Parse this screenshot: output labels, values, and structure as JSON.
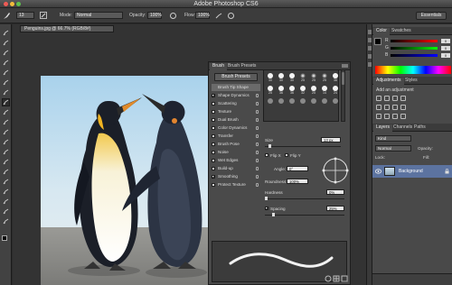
{
  "app": {
    "title": "Adobe Photoshop CS6"
  },
  "options_bar": {
    "brush_size": "13",
    "mode_label": "Mode:",
    "mode_value": "Normal",
    "opacity_label": "Opacity:",
    "opacity_value": "100%",
    "flow_label": "Flow:",
    "flow_value": "100%",
    "workspace": "Essentials"
  },
  "document": {
    "tab_label": "Penguins.jpg @ 66.7% (RGB/8#)"
  },
  "brush_panel": {
    "tabs": [
      "Brush",
      "Brush Presets"
    ],
    "presets_button": "Brush Presets",
    "options": [
      {
        "label": "Brush Tip Shape",
        "checkbox": false,
        "checked": false,
        "lock": false,
        "highlighted": true
      },
      {
        "label": "Shape Dynamics",
        "checkbox": true,
        "checked": true,
        "lock": true,
        "highlighted": false
      },
      {
        "label": "Scattering",
        "checkbox": true,
        "checked": false,
        "lock": true,
        "highlighted": false
      },
      {
        "label": "Texture",
        "checkbox": true,
        "checked": false,
        "lock": true,
        "highlighted": false
      },
      {
        "label": "Dual Brush",
        "checkbox": true,
        "checked": false,
        "lock": true,
        "highlighted": false
      },
      {
        "label": "Color Dynamics",
        "checkbox": true,
        "checked": false,
        "lock": true,
        "highlighted": false
      },
      {
        "label": "Transfer",
        "checkbox": true,
        "checked": false,
        "lock": true,
        "highlighted": false
      },
      {
        "label": "Brush Pose",
        "checkbox": true,
        "checked": false,
        "lock": true,
        "highlighted": false
      },
      {
        "label": "Noise",
        "checkbox": true,
        "checked": false,
        "lock": true,
        "highlighted": false
      },
      {
        "label": "Wet Edges",
        "checkbox": true,
        "checked": false,
        "lock": true,
        "highlighted": false
      },
      {
        "label": "Build-up",
        "checkbox": true,
        "checked": false,
        "lock": true,
        "highlighted": false
      },
      {
        "label": "Smoothing",
        "checkbox": true,
        "checked": true,
        "lock": true,
        "highlighted": false
      },
      {
        "label": "Protect Texture",
        "checkbox": true,
        "checked": false,
        "lock": true,
        "highlighted": false
      }
    ],
    "tip_sizes": [
      "30",
      "30",
      "30",
      "25",
      "25",
      "25",
      "36",
      "25",
      "36",
      "36",
      "32",
      "25",
      "14",
      "24",
      "",
      "",
      "",
      "",
      "",
      "",
      ""
    ],
    "size_label": "Size",
    "size_value": "13 px",
    "flip_x": "Flip X",
    "flip_y": "Flip Y",
    "angle_label": "Angle:",
    "angle_value": "0°",
    "roundness_label": "Roundness:",
    "roundness_value": "100%",
    "hardness_label": "Hardness",
    "hardness_value": "0%",
    "spacing_label": "Spacing",
    "spacing_value": "25%"
  },
  "color_panel": {
    "tabs": [
      "Color",
      "Swatches"
    ],
    "channels": [
      {
        "name": "R",
        "value": "0"
      },
      {
        "name": "G",
        "value": "0"
      },
      {
        "name": "B",
        "value": "0"
      }
    ]
  },
  "adjustments_panel": {
    "tabs": [
      "Adjustments",
      "Styles"
    ],
    "heading": "Add an adjustment"
  },
  "layers_panel": {
    "tabs": [
      "Layers",
      "Channels",
      "Paths"
    ],
    "kind_label": "Kind",
    "blend_mode": "Normal",
    "opacity_label": "Opacity:",
    "lock_label": "Lock:",
    "fill_label": "Fill:",
    "layer_name": "Background"
  },
  "colors": {
    "panel": "#4a4a4a",
    "selection": "#5c73a0",
    "highlight_row": "#6a6a6a"
  }
}
